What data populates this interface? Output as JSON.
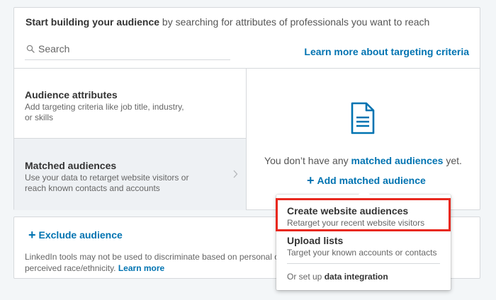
{
  "header": {
    "bold": "Start building your audience",
    "rest": " by searching for attributes of professionals you want to reach"
  },
  "search": {
    "placeholder": "Search"
  },
  "learn_more": "Learn more about targeting criteria",
  "panels": {
    "attributes": {
      "title": "Audience attributes",
      "desc_line1": "Add targeting criteria like job title, industry,",
      "desc_line2": "or skills"
    },
    "matched": {
      "title": "Matched audiences",
      "desc_line1": "Use your data to retarget website visitors or",
      "desc_line2": "reach known contacts and accounts"
    }
  },
  "empty_state": {
    "prefix": "You don’t have any ",
    "link": "matched audiences",
    "suffix": " yet.",
    "add_label": "Add matched audience"
  },
  "exclude": {
    "label": "Exclude audience"
  },
  "disclaimer": {
    "line1": "LinkedIn tools may not be used to discriminate based on personal characteristics",
    "line2": "perceived race/ethnicity. ",
    "link": "Learn more"
  },
  "dropdown": {
    "items": [
      {
        "title": "Create website audiences",
        "desc": "Retarget your recent website visitors"
      },
      {
        "title": "Upload lists",
        "desc": "Target your known accounts or contacts"
      }
    ],
    "footer_prefix": "Or set up ",
    "footer_link": "data integration"
  },
  "colors": {
    "link": "#0073b1",
    "highlight": "#e8281e",
    "selected_panel": "#eef1f4"
  },
  "icons": [
    "search-icon",
    "chevron-right-icon",
    "document-icon",
    "plus-icon"
  ]
}
